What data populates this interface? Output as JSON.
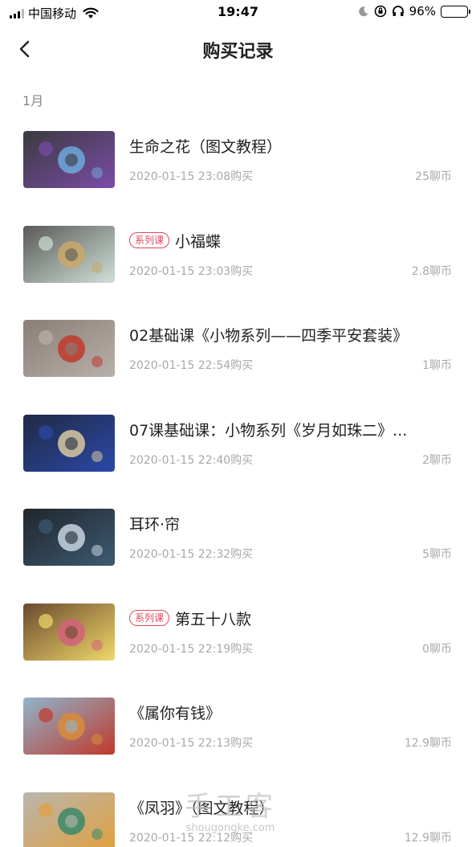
{
  "status_bar": {
    "carrier": "中国移动",
    "time": "19:47",
    "battery": "96%"
  },
  "nav": {
    "title": "购买记录"
  },
  "month_header": "1月",
  "purchases": [
    {
      "title": "生命之花（图文教程）",
      "tag": "",
      "date": "2020-01-15 23:08购买",
      "price": "25聊币",
      "thumb_colors": [
        "#3a3a3e",
        "#7b4ca8",
        "#6fa8dc"
      ]
    },
    {
      "title": "小福蝶",
      "tag": "系列课",
      "date": "2020-01-15 23:03购买",
      "price": "2.8聊币",
      "thumb_colors": [
        "#5a5a58",
        "#cfe0d8",
        "#c9a86a"
      ]
    },
    {
      "title": "02基础课《小物系列——四季平安套装》",
      "tag": "",
      "date": "2020-01-15 22:54购买",
      "price": "1聊币",
      "thumb_colors": [
        "#8a7e76",
        "#b8b0aa",
        "#c0392b"
      ]
    },
    {
      "title": "07课基础课：小物系列《岁月如珠二》...",
      "tag": "",
      "date": "2020-01-15 22:40购买",
      "price": "2聊币",
      "thumb_colors": [
        "#1f2a44",
        "#2c48a8",
        "#d9c9a0"
      ]
    },
    {
      "title": "耳环·帘",
      "tag": "",
      "date": "2020-01-15 22:32购买",
      "price": "5聊币",
      "thumb_colors": [
        "#20262c",
        "#3d5a72",
        "#c8d4e0"
      ]
    },
    {
      "title": "第五十八款",
      "tag": "系列课",
      "date": "2020-01-15 22:19购买",
      "price": "0聊币",
      "thumb_colors": [
        "#6b4a2e",
        "#f0d86a",
        "#d4607a"
      ]
    },
    {
      "title": "《属你有钱》",
      "tag": "",
      "date": "2020-01-15 22:13购买",
      "price": "12.9聊币",
      "thumb_colors": [
        "#8fb4cc",
        "#c0392b",
        "#d98c3a"
      ]
    },
    {
      "title": "《凤羽》（图文教程）",
      "tag": "",
      "date": "2020-01-15 22:12购买",
      "price": "12.9聊币",
      "thumb_colors": [
        "#b9b6ae",
        "#e0a040",
        "#3a8a6a"
      ]
    }
  ],
  "watermark": {
    "logo_text": "手工客",
    "url_text": "shougongke.com"
  }
}
